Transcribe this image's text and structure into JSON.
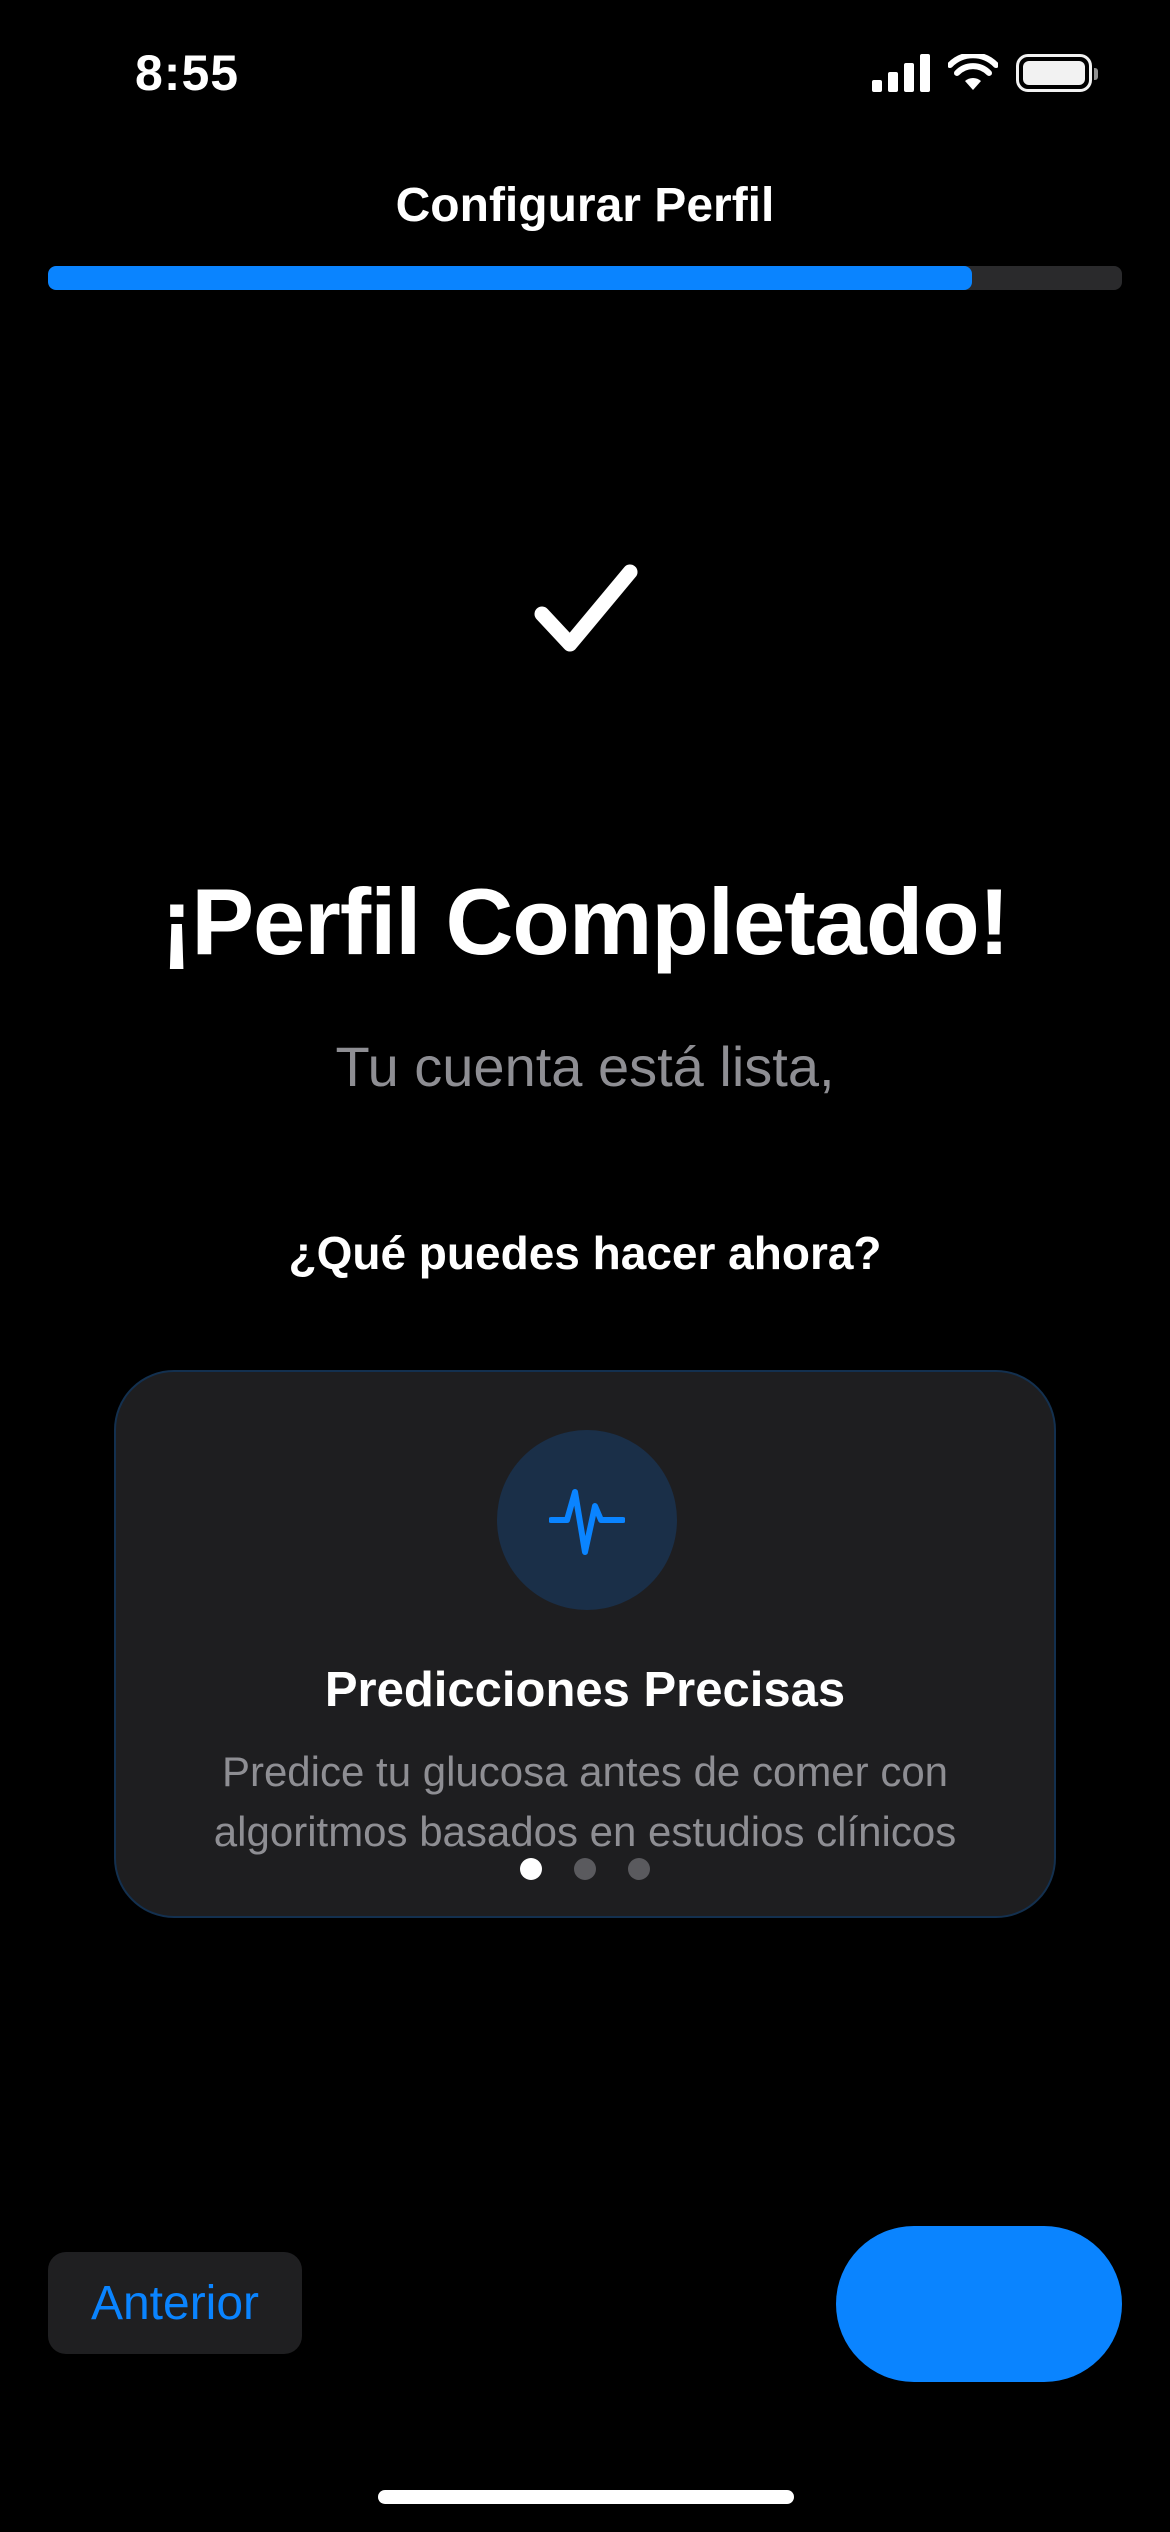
{
  "status_bar": {
    "time": "8:55",
    "icons": [
      "cellular-signal-icon",
      "wifi-icon",
      "battery-icon"
    ]
  },
  "header": {
    "title": "Configurar Perfil",
    "progress": 0.86
  },
  "hero": {
    "icon": "checkmark-icon",
    "title": "¡Perfil Completado!",
    "subtitle": "Tu cuenta está lista,"
  },
  "features": {
    "section_title": "¿Qué puedes hacer ahora?",
    "current": {
      "icon": "waveform-pulse-icon",
      "title": "Predicciones Precisas",
      "description": "Predice tu glucosa antes de comer con algoritmos basados en estudios clínicos"
    },
    "page_count": 3,
    "active_page": 1
  },
  "footer": {
    "previous_label": "Anterior",
    "next_label": ""
  },
  "colors": {
    "accent": "#0a84ff",
    "background": "#000000",
    "card": "#1e1e20",
    "secondary_text": "#8e8e93"
  }
}
